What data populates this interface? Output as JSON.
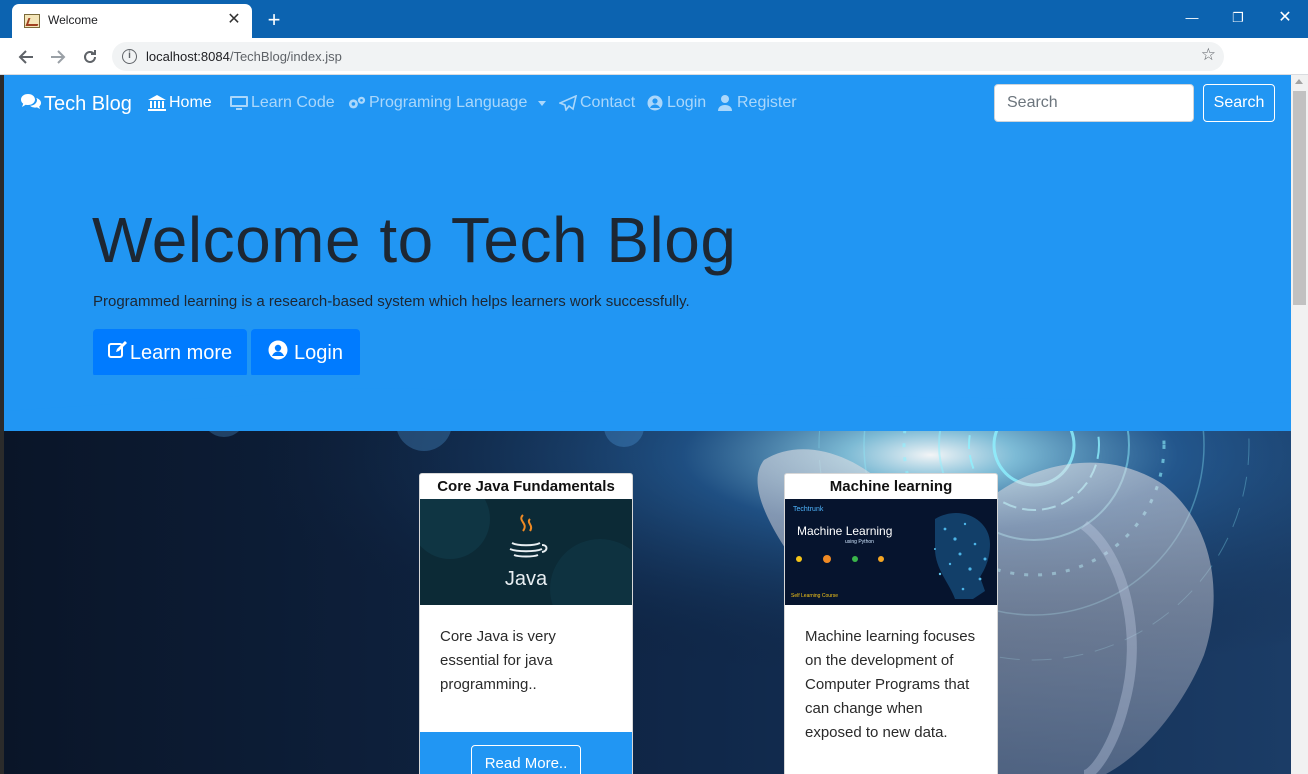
{
  "browser": {
    "tab_title": "Welcome",
    "url_host": "localhost:8084",
    "url_path": "/TechBlog/index.jsp"
  },
  "navbar": {
    "brand": "Tech Blog",
    "items": [
      {
        "label": "Home",
        "icon": "home-icon"
      },
      {
        "label": "Learn Code",
        "icon": "desktop-icon"
      },
      {
        "label": "Programing Language",
        "icon": "cogs-icon"
      },
      {
        "label": "Contact",
        "icon": "paper-plane-icon"
      },
      {
        "label": "Login",
        "icon": "user-circle-icon"
      },
      {
        "label": "Register",
        "icon": "user-icon"
      }
    ],
    "search_placeholder": "Search",
    "search_button": "Search"
  },
  "hero": {
    "title": "Welcome to Tech Blog",
    "subtitle": "Programmed learning is a research-based system which helps learners work successfully.",
    "learn_more": "Learn more",
    "login": "Login"
  },
  "cards": [
    {
      "title": "Core Java Fundamentals",
      "image_caption": "Java",
      "text": "Core Java is very essential for java programming..",
      "button": "Read More.."
    },
    {
      "title": "Machine learning",
      "image_brand": "Techtrunk",
      "image_title": "Machine Learning",
      "image_subtitle": "using Python",
      "image_footer": "Self Learning Course",
      "text": "Machine learning focuses on the development of Computer Programs that can change when exposed to new data."
    }
  ],
  "colors": {
    "primary": "#2196f3",
    "button_blue": "#007bff",
    "browser_frame": "#0c63b0"
  }
}
